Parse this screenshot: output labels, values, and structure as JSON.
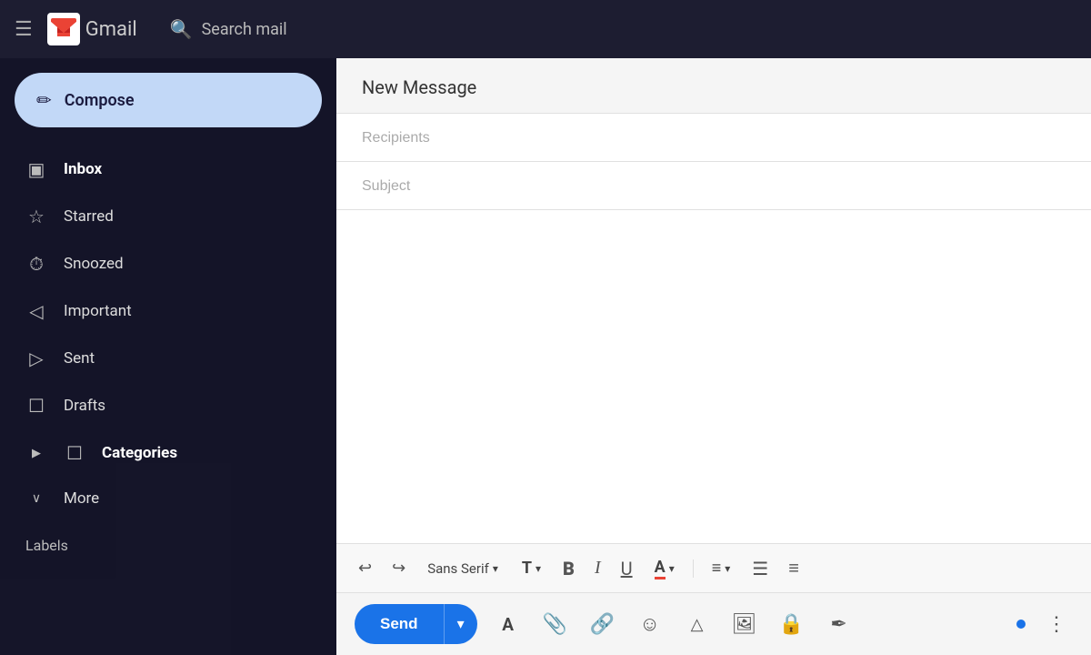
{
  "topbar": {
    "menu_icon": "☰",
    "app_name": "Gmail",
    "search_placeholder": "Search mail"
  },
  "sidebar": {
    "compose_label": "Compose",
    "compose_icon": "✏",
    "nav_items": [
      {
        "id": "inbox",
        "label": "Inbox",
        "icon": "⬛",
        "bold": true
      },
      {
        "id": "starred",
        "label": "Starred",
        "icon": "☆",
        "bold": false
      },
      {
        "id": "snoozed",
        "label": "Snoozed",
        "icon": "⏰",
        "bold": false
      },
      {
        "id": "important",
        "label": "Important",
        "icon": "◁",
        "bold": false
      },
      {
        "id": "sent",
        "label": "Sent",
        "icon": "▷",
        "bold": false
      },
      {
        "id": "drafts",
        "label": "Drafts",
        "icon": "📄",
        "bold": false
      },
      {
        "id": "categories",
        "label": "Categories",
        "icon": "📁",
        "bold": true,
        "expand": true
      },
      {
        "id": "more",
        "label": "More",
        "icon": "∨",
        "bold": false,
        "expand": true
      }
    ],
    "labels_section": "Labels"
  },
  "compose": {
    "title": "New Message",
    "recipients_placeholder": "Recipients",
    "subject_placeholder": "Subject",
    "body_placeholder": ""
  },
  "toolbar": {
    "undo_icon": "↩",
    "redo_icon": "↪",
    "font_name": "Sans Serif",
    "font_size_icon": "T↕",
    "bold_label": "B",
    "italic_label": "I",
    "underline_label": "U",
    "font_color_label": "A",
    "align_icon": "≡",
    "list_icon": "≔",
    "indent_icon": "≡≡"
  },
  "bottom_bar": {
    "send_label": "Send",
    "format_icon": "A",
    "attach_icon": "📎",
    "link_icon": "🔗",
    "emoji_icon": "☺",
    "drive_icon": "△",
    "photo_icon": "🖼",
    "lock_icon": "🔒",
    "signature_icon": "✏",
    "more_icon": "⋮"
  }
}
